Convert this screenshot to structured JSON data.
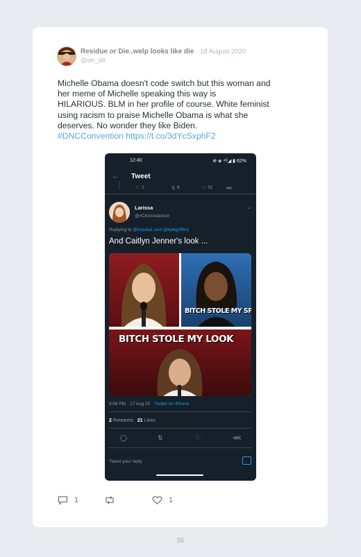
{
  "post": {
    "author_name": "Residue or Die..welp looks like die",
    "separator": "·",
    "date": "18 August 2020",
    "handle": "@oh_dit",
    "text_lines": [
      "Michelle Obama doesn't code switch but this woman and",
      "her meme of Michelle speaking this way is",
      "HILARIOUS. BLM in her profile of course. White feminist",
      "using racism to praise Michelle Obama is what she",
      "deserves. No wonder they like Biden."
    ],
    "hashtag": "#DNCConvention",
    "link": "https://t.co/3dYcSxphF2",
    "reply_count": "1",
    "like_count": "1"
  },
  "embedded": {
    "status_time": "12:40",
    "status_right": "⊕ ◈ ⁴ᴳ◢ ▮ 62%",
    "nav_title": "Tweet",
    "prev_counts": [
      "2",
      "8",
      "32"
    ],
    "author_name": "Larissa",
    "author_handle": "@4Choicedancer",
    "replying_prefix": "Replying to",
    "replying_to": "@txquila1 and @kylegriffin1",
    "text": "And Caitlyn Jenner's look ...",
    "caption_top": "BITCH STOLE MY SPEECH",
    "caption_bottom": "BITCH STOLE MY LOOK",
    "timestamp": "5:06 PM · 17 Aug 20 ·",
    "source": "Twitter for iPhone",
    "retweets": "2",
    "retweets_label": "Retweets",
    "likes": "21",
    "likes_label": "Likes",
    "reply_placeholder": "Tweet your reply"
  },
  "page_number": "55",
  "colors": {
    "accent": "#1d9bf0",
    "dark_bg": "#15202b",
    "link": "#5aa6d8"
  }
}
